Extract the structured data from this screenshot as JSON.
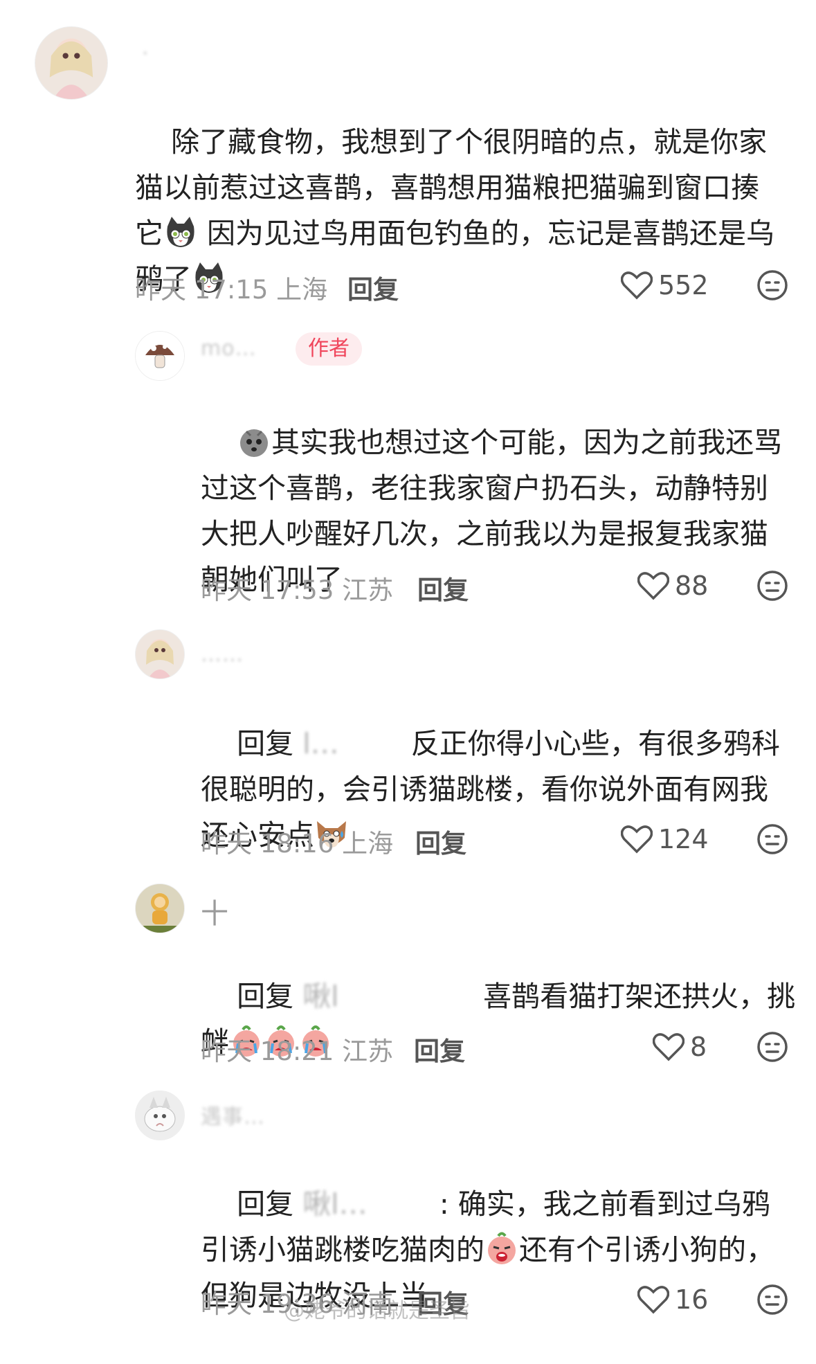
{
  "comments": [
    {
      "name": "·",
      "text_parts": [
        "除了藏食物，我想到了个很阴暗的点，就是你家猫以前惹过这喜鹊，喜鹊想用猫粮把猫骗到窗口揍它",
        " 因为见过鸟用面包钓鱼的，忘记是喜鹊还是乌鸦了"
      ],
      "time": "昨天 17:15 上海",
      "reply": "回复",
      "likes": "552"
    },
    {
      "name": "mo…",
      "badge": "作者",
      "text": "其实我也想过这个可能，因为之前我还骂过这个喜鹊，老往我家窗户扔石头，动静特别大把人吵醒好几次，之前我以为是报复我家猫朝她们叫了",
      "time": "昨天 17:53 江苏",
      "reply": "回复",
      "likes": "88"
    },
    {
      "name": "……",
      "reply_prefix": "回复",
      "reply_to": "l…",
      "text": "反正你得小心些，有很多鸦科很聪明的，会引诱猫跳楼，看你说外面有网我还心安点",
      "time": "昨天 18:16 上海",
      "reply": "回复",
      "likes": "124"
    },
    {
      "name": "十",
      "reply_prefix": "回复",
      "reply_to": "啾l",
      "text": "喜鹊看猫打架还拱火，挑衅",
      "time": "昨天 18:21 江苏",
      "reply": "回复",
      "likes": "8"
    },
    {
      "name": "遇事…",
      "reply_prefix": "回复",
      "reply_to": "啾l…",
      "text_parts": [
        ": 确实，我之前看到过乌鸦引诱小猫跳楼吃猫肉的",
        "还有个引诱小狗的，但狗是边牧没上当"
      ],
      "time": "昨天 19:36 河南",
      "reply": "回复",
      "likes": "16"
    }
  ],
  "watermark": "@姥爷的话就是圣旨",
  "colors": {
    "author_badge_bg": "#fdecee",
    "author_badge_text": "#f0455b",
    "meta": "#9a9a9a"
  }
}
